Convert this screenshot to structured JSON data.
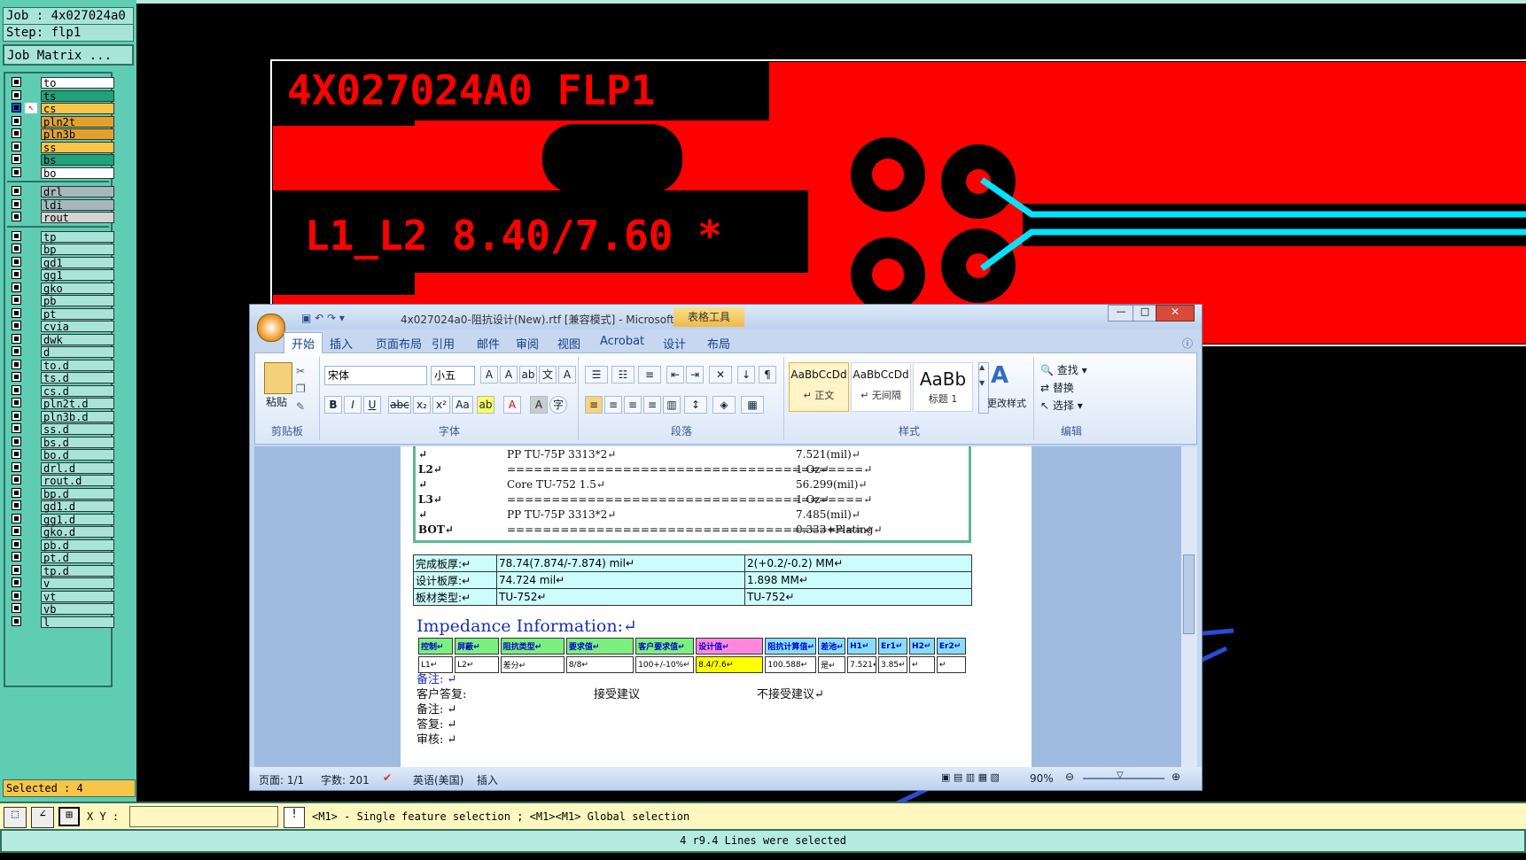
{
  "job_label": "Job : 4x027024a0",
  "step_label": "Step: flp1",
  "job_matrix_button": "Job Matrix ...",
  "layers": [
    {
      "name": "to",
      "color": "#ffffff"
    },
    {
      "name": "ts",
      "color": "#1ea37a"
    },
    {
      "name": "cs",
      "color": "#f7c548"
    },
    {
      "name": "pln2t",
      "color": "#e3a12b"
    },
    {
      "name": "pln3b",
      "color": "#e3a12b"
    },
    {
      "name": "ss",
      "color": "#f7c548"
    },
    {
      "name": "bs",
      "color": "#1ea37a"
    },
    {
      "name": "bo",
      "color": "#ffffff"
    },
    {
      "name": "drl",
      "color": "#a7b8bd"
    },
    {
      "name": "ldi",
      "color": "#a7b8bd"
    },
    {
      "name": "rout",
      "color": "#d4d4d4"
    },
    {
      "name": "tp",
      "color": "#a9e4d8"
    },
    {
      "name": "bp",
      "color": "#a9e4d8"
    },
    {
      "name": "gd1",
      "color": "#a9e4d8"
    },
    {
      "name": "gg1",
      "color": "#a9e4d8"
    },
    {
      "name": "gko",
      "color": "#a9e4d8"
    },
    {
      "name": "pb",
      "color": "#a9e4d8"
    },
    {
      "name": "pt",
      "color": "#a9e4d8"
    },
    {
      "name": "cvia",
      "color": "#a9e4d8"
    },
    {
      "name": "dwk",
      "color": "#a9e4d8"
    },
    {
      "name": "d",
      "color": "#a9e4d8"
    },
    {
      "name": "to.d",
      "color": "#a9e4d8"
    },
    {
      "name": "ts.d",
      "color": "#a9e4d8"
    },
    {
      "name": "cs.d",
      "color": "#a9e4d8"
    },
    {
      "name": "pln2t.d",
      "color": "#a9e4d8"
    },
    {
      "name": "pln3b.d",
      "color": "#a9e4d8"
    },
    {
      "name": "ss.d",
      "color": "#a9e4d8"
    },
    {
      "name": "bs.d",
      "color": "#a9e4d8"
    },
    {
      "name": "bo.d",
      "color": "#a9e4d8"
    },
    {
      "name": "drl.d",
      "color": "#a9e4d8"
    },
    {
      "name": "rout.d",
      "color": "#a9e4d8"
    },
    {
      "name": "bp.d",
      "color": "#a9e4d8"
    },
    {
      "name": "gd1.d",
      "color": "#a9e4d8"
    },
    {
      "name": "gg1.d",
      "color": "#a9e4d8"
    },
    {
      "name": "gko.d",
      "color": "#a9e4d8"
    },
    {
      "name": "pb.d",
      "color": "#a9e4d8"
    },
    {
      "name": "pt.d",
      "color": "#a9e4d8"
    },
    {
      "name": "tp.d",
      "color": "#a9e4d8"
    },
    {
      "name": "v",
      "color": "#a9e4d8"
    },
    {
      "name": "vt",
      "color": "#a9e4d8"
    },
    {
      "name": "vb",
      "color": "#a9e4d8"
    },
    {
      "name": "l",
      "color": "#a9e4d8"
    }
  ],
  "selected_label": "Selected : 4",
  "canvas_text": {
    "title": "4X027024A0 FLP1",
    "impedance": "L1_L2 8.40/7.60 *"
  },
  "word": {
    "title": "4x027024a0-阻抗设计(New).rtf [兼容模式] - Microsoft Wo...",
    "context_tab": "表格工具",
    "tabs": [
      "开始",
      "插入",
      "页面布局",
      "引用",
      "邮件",
      "审阅",
      "视图",
      "Acrobat",
      "设计",
      "布局"
    ],
    "font_name": "宋体",
    "font_size": "小五",
    "groups": [
      "剪贴板",
      "字体",
      "段落",
      "样式",
      "编辑"
    ],
    "paste_label": "粘贴",
    "styles": [
      {
        "preview": "AaBbCcDd",
        "label": "↵ 正文"
      },
      {
        "preview": "AaBbCcDd",
        "label": "↵ 无间隔"
      },
      {
        "preview": "AaBb",
        "label": "标题 1"
      }
    ],
    "change_styles": "更改样式",
    "edit_items": [
      "查找 ▾",
      "替换",
      "选择 ▾"
    ],
    "stackup": [
      {
        "label": "↵",
        "mid": "PP      TU-75P     3313*2↵",
        "right": "7.521(mil)↵"
      },
      {
        "label": "L2↵",
        "mid": "========================================↵",
        "right": "1 Oz↵"
      },
      {
        "label": "↵",
        "mid": "Core      TU-752      1.5↵",
        "right": "56.299(mil)↵"
      },
      {
        "label": "L3↵",
        "mid": "========================================↵",
        "right": "1 Oz↵"
      },
      {
        "label": "↵",
        "mid": "PP      TU-75P     3313*2↵",
        "right": "7.485(mil)↵"
      },
      {
        "label": "BOT↵",
        "mid": "========================================↵",
        "right": "0.333+Plating↵"
      }
    ],
    "board": [
      [
        "完成板厚:↵",
        "78.74(7.874/-7.874) mil↵",
        "2(+0.2/-0.2) MM↵"
      ],
      [
        "设计板厚:↵",
        "74.724 mil↵",
        "1.898 MM↵"
      ],
      [
        "板材类型:↵",
        "TU-752↵",
        "TU-752↵"
      ]
    ],
    "impedance_heading": "Impedance Information:↵",
    "imp_headers": [
      "控制↵",
      "屏蔽↵",
      "阻抗类型↵",
      "要求值↵",
      "客户要求值↵",
      "设计值↵",
      "阻抗计算值↵",
      "差池↵",
      "H1↵",
      "Er1↵",
      "H2↵",
      "Er2↵"
    ],
    "imp_row": [
      "L1↵",
      "L2↵",
      "差分↵",
      "8/8↵",
      "100+/-10%↵",
      "8.4/7.6↵",
      "100.588↵",
      "是↵",
      "7.521↵",
      "3.85↵",
      "↵",
      "↵"
    ],
    "notes": [
      {
        "left": "备注: ↵",
        "mid": "",
        "right": ""
      },
      {
        "left": "客户答复:",
        "mid": "接受建议",
        "right": "不接受建议↵"
      },
      {
        "left": "备注: ↵",
        "mid": "",
        "right": ""
      },
      {
        "left": "答复: ↵",
        "mid": "",
        "right": ""
      },
      {
        "left": "审核: ↵",
        "mid": "",
        "right": ""
      }
    ],
    "status": {
      "page": "页面: 1/1",
      "words": "字数: 201",
      "lang": "英语(美国)",
      "mode": "插入",
      "zoom": "90%"
    }
  },
  "bottom": {
    "xy_label": "X Y :",
    "xy_value": "",
    "hint": "<M1> - Single feature selection ; <M1><M1> Global selection",
    "message": "4 r9.4 Lines were selected"
  },
  "colors": {
    "panel": "#5fcdb4",
    "pcb_red": "#ff0000",
    "trace": "#00e5ff",
    "highlight": "#ffff00"
  }
}
